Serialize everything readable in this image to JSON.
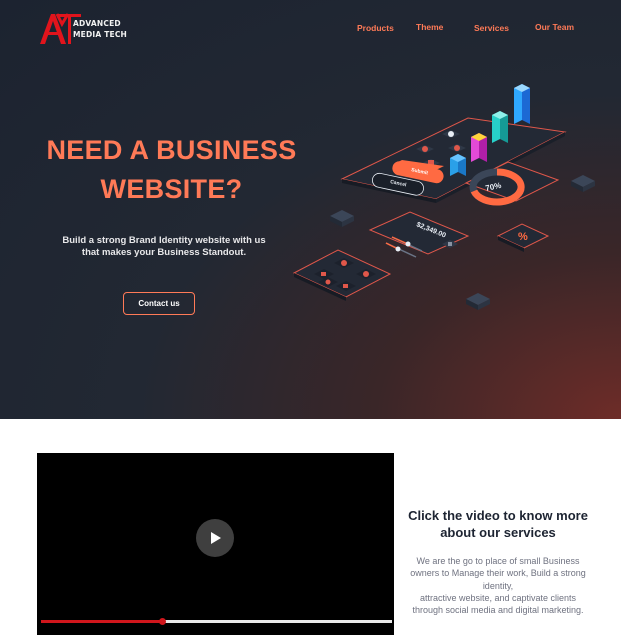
{
  "brand": {
    "logo_line1": "ADVANCED",
    "logo_line2": "MEDIA TECH",
    "accent_color": "#ff7a57",
    "logo_color": "#e1141c"
  },
  "nav": {
    "items": [
      {
        "label": "Products"
      },
      {
        "label": "Theme"
      },
      {
        "label": "Services"
      },
      {
        "label": "Our Team"
      }
    ]
  },
  "hero": {
    "headline_line1": "NEED A BUSINESS",
    "headline_line2": "WEBSITE?",
    "subtitle_line1": "Build a strong Brand Identity website with us",
    "subtitle_line2": "that makes your Business Standout.",
    "cta_label": "Contact us"
  },
  "illustration": {
    "button_primary": "Submit",
    "button_secondary": "Cancel",
    "donut_percent": "70%",
    "amount": "$2,349.00",
    "percent_symbol": "%"
  },
  "video": {
    "progress_fraction": 0.345
  },
  "about": {
    "title_line1": "Click the video to know more",
    "title_line2": "about our services",
    "text_line1": "We  are the  go to place of small Business",
    "text_line2": "owners to Manage their work, Build  a strong",
    "text_line3": "identity,",
    "text_line4": "attractive website, and captivate clients",
    "text_line5": "through social media and digital marketing."
  }
}
